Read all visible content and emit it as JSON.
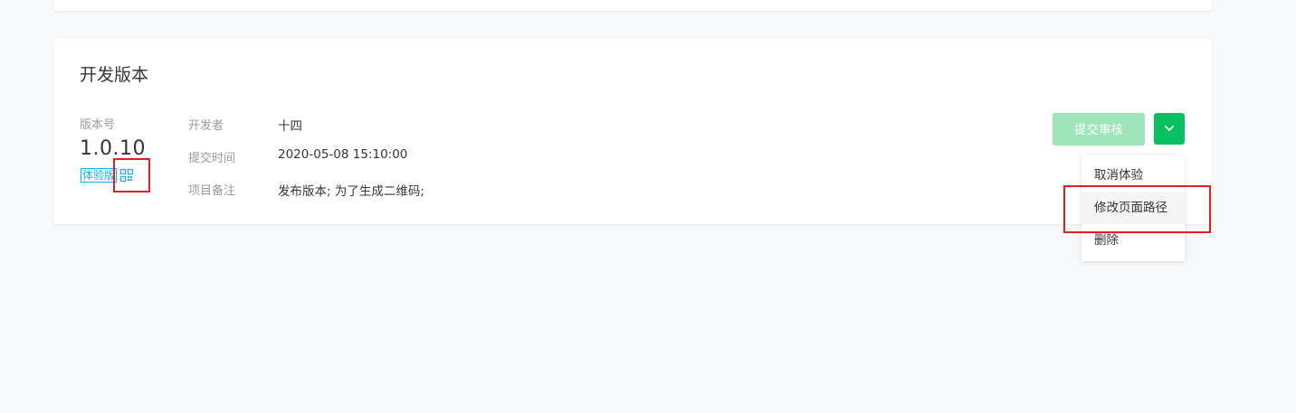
{
  "section": {
    "title": "开发版本"
  },
  "version": {
    "label": "版本号",
    "number": "1.0.10",
    "badge": "体验版",
    "qr_icon": "qrcode-icon"
  },
  "info": [
    {
      "label": "开发者",
      "value": "十四"
    },
    {
      "label": "提交时间",
      "value": "2020-05-08 15:10:00"
    },
    {
      "label": "项目备注",
      "value": "发布版本; 为了生成二维码;"
    }
  ],
  "actions": {
    "submit_label": "提交审核",
    "submit_state": "disabled",
    "dropdown_icon": "chevron-down-icon"
  },
  "menu": {
    "items": [
      {
        "label": "取消体验"
      },
      {
        "label": "修改页面路径"
      },
      {
        "label": "删除"
      }
    ],
    "hovered_item": "修改页面路径"
  },
  "colors": {
    "accent": "#07c160",
    "accent_disabled": "#9ee5b9",
    "badge": "#10aeff",
    "highlight": "#e02020",
    "background": "#f7f8fa"
  }
}
